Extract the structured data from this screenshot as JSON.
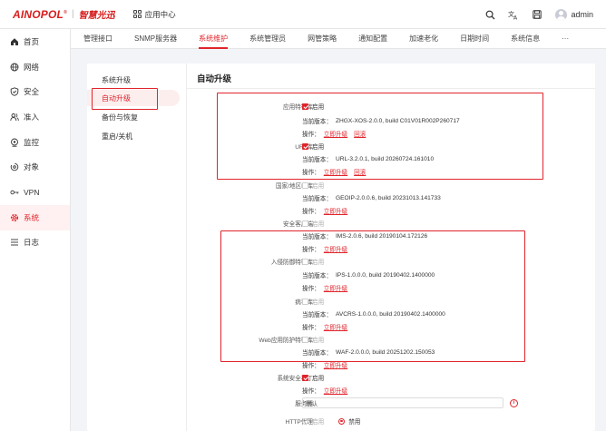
{
  "brand": {
    "logo": "AINOPOL",
    "reg": "®",
    "separator": "|",
    "chinese": "智慧光迅"
  },
  "header": {
    "app_center": "应用中心",
    "user": "admin"
  },
  "nav": [
    {
      "label": "首页",
      "icon": "home-icon"
    },
    {
      "label": "网络",
      "icon": "globe-icon"
    },
    {
      "label": "安全",
      "icon": "shield-icon"
    },
    {
      "label": "准入",
      "icon": "users-icon"
    },
    {
      "label": "监控",
      "icon": "monitor-icon"
    },
    {
      "label": "对象",
      "icon": "object-icon"
    },
    {
      "label": "VPN",
      "icon": "key-icon"
    },
    {
      "label": "系统",
      "icon": "gear-icon",
      "active": true
    },
    {
      "label": "日志",
      "icon": "list-icon"
    }
  ],
  "tabs": [
    "管理接口",
    "SNMP服务器",
    "系统维护",
    "系统管理员",
    "网管策略",
    "通知配置",
    "加速老化",
    "日期时间",
    "系统信息",
    "···"
  ],
  "active_tab": "系统维护",
  "subnav": [
    "系统升级",
    "自动升级",
    "备份与恢复",
    "重启/关机"
  ],
  "page_title": "自动升级",
  "text": {
    "enable": "启用",
    "disable": "禁用",
    "current_version": "当前版本：",
    "operation": "操作：",
    "upgrade_now": "立即升级",
    "rollback": "回滚"
  },
  "rows": {
    "app_sig": {
      "label": "应用特征库",
      "enabled": true,
      "version": "ZHGX-XOS-2.0.0, build C01V01R002P260717",
      "rollback": true
    },
    "url": {
      "label": "URL库",
      "enabled": true,
      "version": "URL-3.2.0.1, build 20260724.161010",
      "rollback": true
    },
    "geoip": {
      "label": "国家/地区IP库",
      "enabled": false,
      "version": "GEOIP-2.0.0.6, build 20231013.141733"
    },
    "sec_client": {
      "label": "安全客户端",
      "enabled": false,
      "version": "IMS-2.0.6, build 20190104.172126"
    },
    "ips": {
      "label": "入侵防御特征库",
      "enabled": false,
      "version": "IPS-1.0.0.0, build 20190402.1400000"
    },
    "av": {
      "label": "病毒库",
      "enabled": false,
      "version": "AVCRS-1.0.0.0, build 20190402.1400000"
    },
    "waf": {
      "label": "Web应用防护特征库",
      "enabled": false,
      "version": "WAF-2.0.0.0, build 20251202.150053"
    },
    "patch": {
      "label": "系统安全补丁",
      "enabled": true
    },
    "server": {
      "label": "服务器",
      "value": "默认"
    },
    "proxy": {
      "label": "HTTP代理",
      "option1": "启用",
      "option2": "禁用",
      "selected": "禁用"
    }
  },
  "colors": {
    "accent": "#e0242b"
  }
}
